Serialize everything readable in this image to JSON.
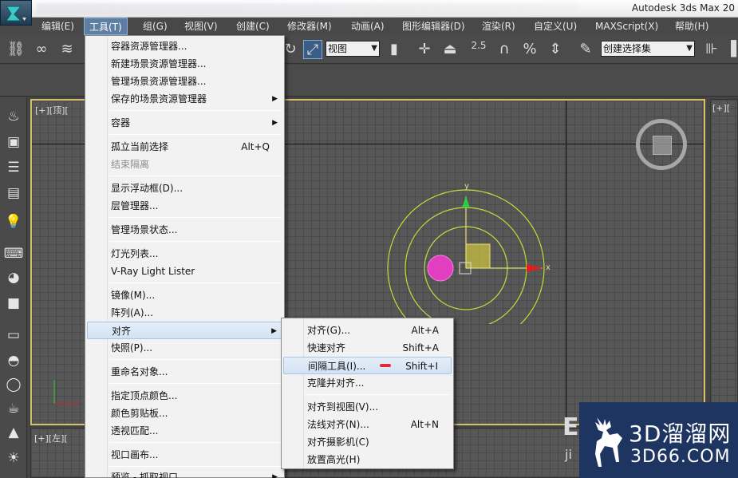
{
  "app": {
    "title": "Autodesk 3ds Max  20"
  },
  "menubar": [
    {
      "label": "编辑(E)",
      "active": false
    },
    {
      "label": "工具(T)",
      "active": true
    },
    {
      "label": "组(G)",
      "active": false
    },
    {
      "label": "视图(V)",
      "active": false
    },
    {
      "label": "创建(C)",
      "active": false
    },
    {
      "label": "修改器(M)",
      "active": false
    },
    {
      "label": "动画(A)",
      "active": false
    },
    {
      "label": "图形编辑器(D)",
      "active": false
    },
    {
      "label": "渲染(R)",
      "active": false
    },
    {
      "label": "自定义(U)",
      "active": false
    },
    {
      "label": "MAXScript(X)",
      "active": false
    },
    {
      "label": "帮助(H)",
      "active": false
    }
  ],
  "toolbar": {
    "coord_dropdown": "视图",
    "selection_set_dropdown": "创建选择集",
    "snap_value": "2.5"
  },
  "viewports": {
    "top_left_label": "[+][顶][",
    "top_right_label": "[+][",
    "bottom_left_label": "[+][左][",
    "gizmo_axis_y": "y",
    "gizmo_axis_x": "x"
  },
  "tools_menu": {
    "items": [
      {
        "label": "容器资源管理器...",
        "shortcut": "",
        "submenu": false,
        "disabled": false
      },
      {
        "label": "新建场景资源管理器...",
        "shortcut": "",
        "submenu": false,
        "disabled": false
      },
      {
        "label": "管理场景资源管理器...",
        "shortcut": "",
        "submenu": false,
        "disabled": false
      },
      {
        "label": "保存的场景资源管理器",
        "shortcut": "",
        "submenu": true,
        "disabled": false
      },
      {
        "label": "容器",
        "shortcut": "",
        "submenu": true,
        "disabled": false
      },
      {
        "label": "孤立当前选择",
        "shortcut": "Alt+Q",
        "submenu": false,
        "disabled": false
      },
      {
        "label": "结束隔离",
        "shortcut": "",
        "submenu": false,
        "disabled": true
      },
      {
        "label": "显示浮动框(D)...",
        "shortcut": "",
        "submenu": false,
        "disabled": false
      },
      {
        "label": "层管理器...",
        "shortcut": "",
        "submenu": false,
        "disabled": false
      },
      {
        "label": "管理场景状态...",
        "shortcut": "",
        "submenu": false,
        "disabled": false
      },
      {
        "label": "灯光列表...",
        "shortcut": "",
        "submenu": false,
        "disabled": false
      },
      {
        "label": "V-Ray Light Lister",
        "shortcut": "",
        "submenu": false,
        "disabled": false
      },
      {
        "label": "镜像(M)...",
        "shortcut": "",
        "submenu": false,
        "disabled": false
      },
      {
        "label": "阵列(A)...",
        "shortcut": "",
        "submenu": false,
        "disabled": false
      },
      {
        "label": "对齐",
        "shortcut": "",
        "submenu": true,
        "disabled": false,
        "highlighted": true
      },
      {
        "label": "快照(P)...",
        "shortcut": "",
        "submenu": false,
        "disabled": false
      },
      {
        "label": "重命名对象...",
        "shortcut": "",
        "submenu": false,
        "disabled": false
      },
      {
        "label": "指定顶点颜色...",
        "shortcut": "",
        "submenu": false,
        "disabled": false
      },
      {
        "label": "颜色剪贴板...",
        "shortcut": "",
        "submenu": false,
        "disabled": false
      },
      {
        "label": "透视匹配...",
        "shortcut": "",
        "submenu": false,
        "disabled": false
      },
      {
        "label": "视口画布...",
        "shortcut": "",
        "submenu": false,
        "disabled": false
      },
      {
        "label": "预览 - 抓取视口",
        "shortcut": "",
        "submenu": true,
        "disabled": false
      }
    ]
  },
  "align_submenu": {
    "items": [
      {
        "label": "对齐(G)...",
        "shortcut": "Alt+A"
      },
      {
        "label": "快速对齐",
        "shortcut": "Shift+A"
      },
      {
        "label": "间隔工具(I)...",
        "shortcut": "Shift+I",
        "highlighted": true
      },
      {
        "label": "克隆并对齐...",
        "shortcut": ""
      },
      {
        "label": "对齐到视图(V)...",
        "shortcut": ""
      },
      {
        "label": "法线对齐(N)...",
        "shortcut": "Alt+N"
      },
      {
        "label": "对齐摄影机(C)",
        "shortcut": ""
      },
      {
        "label": "放置高光(H)",
        "shortcut": ""
      }
    ]
  },
  "watermark": {
    "brand": "3D溜溜网",
    "url": "3D66.COM",
    "ghost_text": "E",
    "ghost_sub": "ji"
  },
  "colors": {
    "menu_highlight": "#d3e2f4",
    "viewport_active_border": "#d6c06a",
    "gizmo_circle": "#b8e23c",
    "gizmo_y_axis": "#2ecc40",
    "gizmo_x_axis": "#e02020",
    "gizmo_plane": "#c8c040",
    "object_pink": "#e040c0",
    "watermark_bg": "#1e3461"
  }
}
